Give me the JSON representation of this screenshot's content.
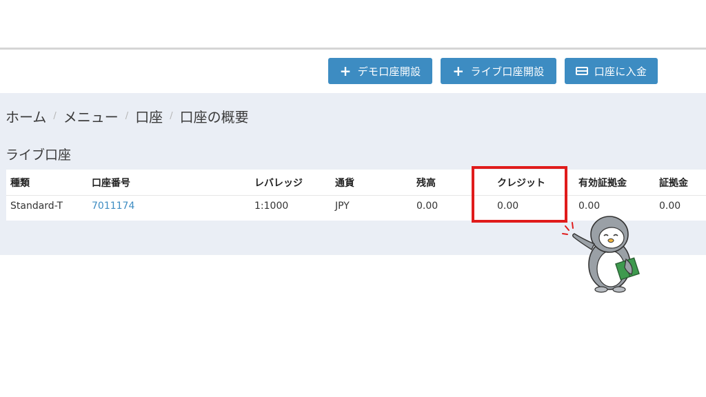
{
  "toolbar": {
    "demo_button": "デモ口座開設",
    "live_button": "ライブ口座開設",
    "deposit_button": "口座に入金"
  },
  "breadcrumb": {
    "items": [
      "ホーム",
      "メニュー",
      "口座",
      "口座の概要"
    ],
    "separator": "/"
  },
  "section_title": "ライブ口座",
  "accounts_table": {
    "headers": [
      "種類",
      "口座番号",
      "レバレッジ",
      "通貨",
      "残高",
      "クレジット",
      "有効証拠金",
      "証拠金"
    ],
    "rows": [
      {
        "type": "Standard-T",
        "account_number": "7011174",
        "leverage": "1:1000",
        "currency": "JPY",
        "balance": "0.00",
        "credit": "0.00",
        "equity": "0.00",
        "margin": "0.00"
      }
    ]
  },
  "colors": {
    "accent": "#3d8cc2",
    "highlight": "#e01b1b",
    "panel_background": "#eaeef5"
  },
  "icons": {
    "demo_button": "plus-icon",
    "live_button": "plus-icon",
    "deposit_button": "credit-card-icon"
  }
}
